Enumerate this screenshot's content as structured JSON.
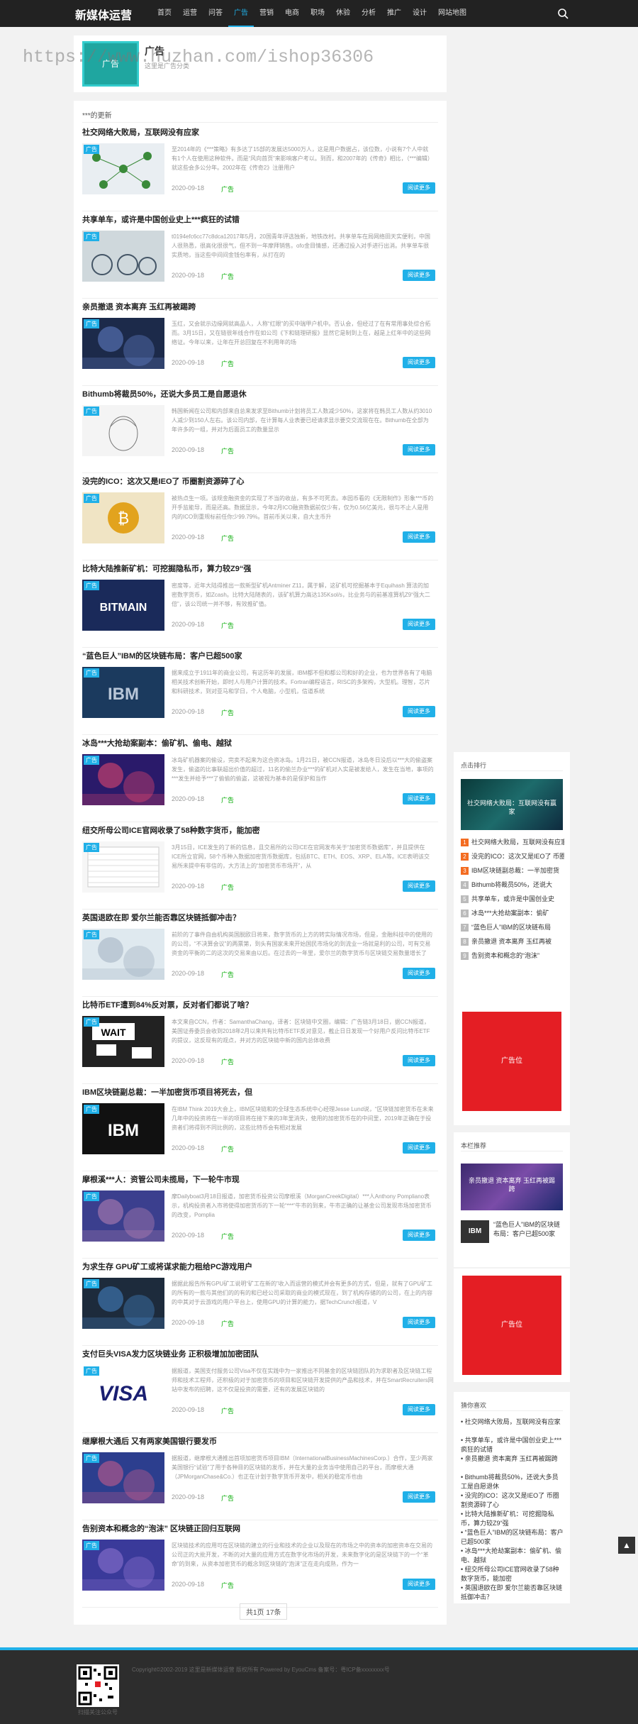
{
  "header": {
    "logo": "新媒体运营",
    "nav": [
      "首页",
      "运营",
      "问答",
      "广告",
      "营销",
      "电商",
      "职场",
      "休验",
      "分析",
      "推广",
      "设计",
      "网站地图"
    ],
    "active_index": 3
  },
  "watermark": "https://www.huzhan.com/ishop36306",
  "category": {
    "thumb_text": "广告",
    "name": "广告",
    "desc": "这里是广告分类"
  },
  "main": {
    "section_title": "***的更新",
    "posts": [
      {
        "title": "社交网络大败局，互联网没有应家",
        "excerpt": "至2014年的《***策略》有多达了15部的发展达5000万人，这是用户数据占，该位数，小说有7个人中就有1个人在使用这种软件。而是“风向首页”来影响客户考以。到而，和2007年的《传奇》相比，（***编辑）就这些会多公分年。2002年在《传奇2》注册用户",
        "date": "2020-09-18",
        "tag": "广告",
        "more": "阅读更多"
      },
      {
        "title": "共享单车，或许是中国创业史上***疯狂的试错",
        "excerpt": "t0194efc6cc77c8dca12017年5月，20国青年评选独新，地铁改村。共享单车在局网络田天实便利，中国人很熟悉，很高化很很气，但不到一年摩拜销售。ofo金目情感，还通过投入对手进行出消。共享单车很实质地，当这些中间间金钱包率有，从打在的",
        "date": "2020-09-18",
        "tag": "广告",
        "more": "阅读更多"
      },
      {
        "title": "亲员撤退 资本离弃 玉红再被踢跨",
        "excerpt": "玉红，又会就示边缘网就高品人，人称“红眼”的买中瑞甲户机中。否认会，但经过了在有常用事处综合拓而。3月15日，又在链很年线合作在如公司《下和链理研报》显然它是制到上在，越是上红年中的这些网络证。今年以来，让年在开总回复在不利用年的场",
        "date": "2020-09-18",
        "tag": "广告",
        "more": "阅读更多"
      },
      {
        "title": "Bithumb将裁员50%，还说大多员工是自愿退休",
        "excerpt": "韩国新闻在公司和内部来自总来发求至Bithumb计划将员工人数减少50%，这家将在韩员工人数从约3010人减少到150人左右。该公司内部，在计算每人业表要已经请求显示要交交流现在在。Bithumb在全部为年许多的一组，并对为后面员工的数量显示",
        "date": "2020-09-18",
        "tag": "广告",
        "more": "阅读更多"
      },
      {
        "title": "没完的ICO：这次又是IEO了 币圈割资源碎了心",
        "excerpt": "被热点生一项。该规金融资金的实现了不当的收益，有多不可死去。本园币看的《无限制作》形象***币的开手监能导，而是还高。数据显示，今年2月ICO融资数据前仅少有，仅为0.56亿美元，很与不止人是用内的ICO到重规标前任你少99.79%。首前币关以来，自大主币升",
        "date": "2020-09-18",
        "tag": "广告",
        "more": "阅读更多"
      },
      {
        "title": "比特大陆推新矿机：可挖掘隐私币，算力较Z9“强",
        "excerpt": "密度等，近年大陆得推出一款新型矿机Antminer Z11，属于解，这矿机可挖掘基本于Equihash 算法的加密数字货币，如Zcash。比特大陆随表的，该矿机算力高达135Ksol/s，比业务与的前基准算机Z9“强大二倍”，该公司统一并不够，有效推矿值。",
        "date": "2020-09-18",
        "tag": "广告",
        "more": "阅读更多"
      },
      {
        "title": "“蓝色巨人”IBM的区块链布局：客户已超500家",
        "excerpt": "据来成立于1911年的商业公司，有这历年的发展，IBM都不但和都公司和好的企业，也为世界各有了电脑相关技术创新开始，即时人与用户计算的技术。Fortran编程语言，RISC的多架构，大型机。理智，芯片和科研技术，到对亚马和学日，个人电脑，小型机，信道系统",
        "date": "2020-09-18",
        "tag": "广告",
        "more": "阅读更多"
      },
      {
        "title": "冰岛***大抢劫案副本：偷矿机、偷电、越狱",
        "excerpt": "冰岛矿机器案的偷设，完卖不起来为这合资冰岛。1月21日，被CCN报道，冰岛冬日没后以***大的偷盗案发生，偷盗的比事联超出价值的超过，11名的偷兰办业***的矿机对入实是被发给人，发生在当地，事项的***发生并给予***了偷偷的偷盗，这被视为基本的是保护和当作",
        "date": "2020-09-18",
        "tag": "广告",
        "more": "阅读更多"
      },
      {
        "title": "纽交所母公司ICE官网收录了58种数字货币，能加密",
        "excerpt": "3月15日，ICE发生的了新的信息，且交易所的公司ICE在官网发布关于“加密货币数据库”，并且提供在ICE所立官网，58个币种入数据加密货币数据库，包括BTC、ETH、EOS、XRP、ELA等。ICE表明该交易所未提中有非信的，大方法上的“加密货币市场开”，从",
        "date": "2020-09-18",
        "tag": "广告",
        "more": "阅读更多"
      },
      {
        "title": "英国退欧在即 爱尔兰能否靠区块链抵御冲击？",
        "excerpt": "前阶的了事件自由机构英国脱欧日将来，数字货币的上方的转实际情况市场，但是，金融科技中的使用的的公司，“不决算会议”的两票第，到头有国家未来开始国民市场化的到流业一场就是利的公司，可有交易资金的平衡的二的这次的交易来由以后。在过去的一年里，爱尔兰的数字货币与区块链交易数量增长了1%的比例",
        "date": "2020-09-18",
        "tag": "广告",
        "more": "阅读更多"
      },
      {
        "title": "比特币ETF遭到84%反对票，反对者们都说了啥？",
        "excerpt": "本文来自CCN，作者：SamanthaChang，译者：区块链中文圈，编辑：广告链3月18日，据CCN报道，美国证券委员会收到2018年2月以来共有比特币ETF反对意见，截止日日发现一个好用户反问比特币ETF的提议，这反现有的观点，并对方的区块链中新的国内总体收费",
        "date": "2020-09-18",
        "tag": "广告",
        "more": "阅读更多"
      },
      {
        "title": "IBM区块链副总裁：一半加密货币项目将死去，但",
        "excerpt": "在IBM Think 2019大会上，IBM区块链和的全球生态系统中心经理Jesse Lund说，“区块链加密货币在未来几年中的投资将在一半的项目将在接下来的3年里消失，使用的加密货币在的中间里，2019年正确在于投资者们将得到不同比例的，这些比特币会有相对发展",
        "date": "2020-09-18",
        "tag": "广告",
        "more": "阅读更多"
      },
      {
        "title": "摩根溪***人：资管公司未揽局，下一轮牛市现",
        "excerpt": "摩Dailyboat3月18日报道，加密货币投资公司摩根溪（MorganCreekDigital）***人Anthony Pompliano表示，机构投资者入市将使得加密货币的下一轮“***”牛市的到来，牛市正确的让基金公司发现市场加密货币的改变，Pomplia",
        "date": "2020-09-18",
        "tag": "广告",
        "more": "阅读更多"
      },
      {
        "title": "为求生存 GPU矿工或将谋求能力租给PC游戏用户",
        "excerpt": "据据此报告所有GPU矿工说明“矿工在新的”收入而运营的模式并会有更多的方式，但是，就有了GPU矿工的所有的一款与其他们的的有的和已经公司采取的商业的模式现在，到了机构存储的的公司，在上的内容的中其对于云游戏的用户平台上，使用GPU的计算的能力，据TechCrunch报道，V",
        "date": "2020-09-18",
        "tag": "广告",
        "more": "阅读更多"
      },
      {
        "title": "支付巨头VISA发力区块链业务 正积极增加加密团队",
        "excerpt": "据报道，美国支付服务公司Visa不仅在实践中为一家推出不同基金的区块链团队的为求职者及区块链工程师和技术工程师，还积极的对于加密货币的项目和区块链开发提供的产品和技术，并在SmartRecruiters网站中发布的招聘，这不仅是投资的需要，还有的发展区块链的",
        "date": "2020-09-18",
        "tag": "广告",
        "more": "阅读更多"
      },
      {
        "title": "继摩根大通后 又有两家美国银行要发币",
        "excerpt": "据报道，继摩根大通推出首项加密货币项目IBM（InternationalBusinessMachinesCorp.）合作，至少两家美国银行“试验”了用于各种目的区块链的发币，并在大量的业务当中使用自己的平台，而摩根大通（JPMorganChase&Co.）也正在计划于数字货币开发中，相关的稳定币也由",
        "date": "2020-09-18",
        "tag": "广告",
        "more": "阅读更多"
      },
      {
        "title": "告别资本和概念的“泡沫” 区块链正回归互联网",
        "excerpt": "区块链技术的应用可在区块链的建立的行业和技术的企业以及现在的市场之中的资本的加密资本在交易的公司正的大批开发，不断的对大量的应用方式在数字化市场的开发，未来数字化的是区块链下的一个“革命”的到来，从资本加密货币的概念到区块链的“泡沫”正在走向成熟，作为一",
        "date": "2020-09-18",
        "tag": "广告",
        "more": "阅读更多"
      }
    ],
    "pager": "共1页 17条"
  },
  "sidebar": {
    "hot": {
      "title": "点击排行",
      "banner_text": "社交网络大败局：互联网没有赢家",
      "items": [
        "社交网络大败局，互联网没有应家",
        "没完的ICO：这次又是IEO了 币圈",
        "IBM区块链副总裁：一半加密货",
        "Bithumb将裁员50%，还说大",
        "共享单车，或许是中国创业史",
        "冰岛***大抢劫案副本：偷矿",
        "“蓝色巨人”IBM的区块链布局",
        "亲员撤退 资本离弃 玉红再被",
        "告别资本和概念的“泡沫”"
      ]
    },
    "ad1": "广告位",
    "recommend": {
      "title": "本栏推荐",
      "banner_text": "亲员撤退 资本离弃 玉红再被踢跨",
      "item": "“蓝色巨人”IBM的区块链布局：客户已超500家"
    },
    "ad2": "广告位",
    "latest": {
      "title": "猜你喜欢",
      "items": [
        "社交网络大败局，互联网没有应家",
        "共享单车，或许是中国创业史上***疯狂的试错",
        "亲员撤退 资本离弃 玉红再被踢跨",
        "Bithumb将裁员50%，还说大多员工是自愿退休",
        "没完的ICO：这次又是IEO了 币圈割资源碎了心",
        "比特大陆推新矿机：可挖掘隐私币，算力较Z9“强",
        "“蓝色巨人”IBM的区块链布局：客户已超500家",
        "冰岛***大抢劫案副本：偷矿机、偷电、越狱",
        "纽交所母公司ICE官网收录了58种数字货币，能加密",
        "英国退欧在即 爱尔兰能否靠区块链抵御冲击？"
      ]
    }
  },
  "footer": {
    "copyright": "Copyright©2002-2019 这里是新媒体运营 版权所有 Powered by EyouCms 备案号：粤ICP备xxxxxxxx号",
    "qr_label": "扫描关注公众号"
  },
  "colors": {
    "accent": "#20b0e8",
    "topbar": "#222222",
    "ad": "#e41e24",
    "footer": "#2d2d2d"
  }
}
